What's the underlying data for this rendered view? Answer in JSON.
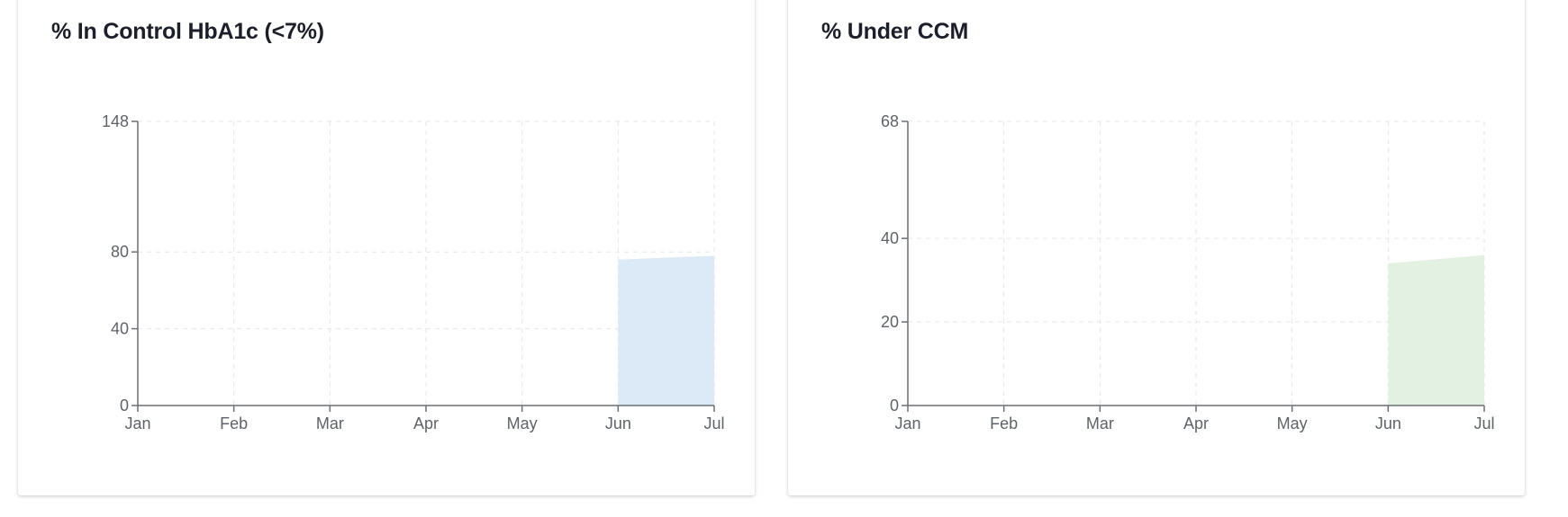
{
  "chart_data": [
    {
      "type": "area",
      "title": "% In Control HbA1c (<7%)",
      "categories": [
        "Jan",
        "Feb",
        "Mar",
        "Apr",
        "May",
        "Jun",
        "Jul"
      ],
      "series": [
        {
          "values": [
            null,
            null,
            null,
            null,
            null,
            76,
            78
          ]
        }
      ],
      "y_ticks": [
        0,
        40,
        80,
        148
      ],
      "ylim": [
        0,
        148
      ],
      "grid": true,
      "fill_color": "#dce9f7"
    },
    {
      "type": "area",
      "title": "% Under CCM",
      "categories": [
        "Jan",
        "Feb",
        "Mar",
        "Apr",
        "May",
        "Jun",
        "Jul"
      ],
      "series": [
        {
          "values": [
            null,
            null,
            null,
            null,
            null,
            34,
            36
          ]
        }
      ],
      "y_ticks": [
        0,
        20,
        40,
        68
      ],
      "ylim": [
        0,
        68
      ],
      "grid": true,
      "fill_color": "#e2f1e1"
    }
  ]
}
